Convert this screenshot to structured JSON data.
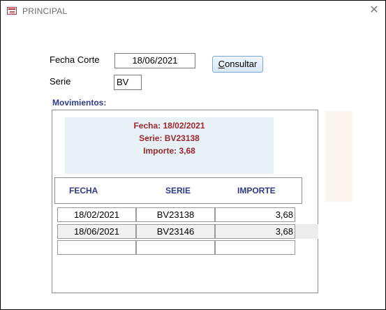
{
  "window": {
    "title": "PRINCIPAL",
    "close_glyph": "✕"
  },
  "form": {
    "fecha_corte_label": "Fecha Corte",
    "fecha_corte_value": "18/06/2021",
    "serie_label": "Serie",
    "serie_value": "BV",
    "consultar_label_first": "C",
    "consultar_label_rest": "onsultar"
  },
  "movimientos": {
    "label": "Movimientos:",
    "summary": {
      "fecha": "Fecha: 18/02/2021",
      "serie": "Serie: BV23138",
      "importe": "Importe: 3,68"
    },
    "columns": [
      "FECHA",
      "SERIE",
      "IMPORTE"
    ],
    "rows": [
      {
        "fecha": "18/02/2021",
        "serie": "BV23138",
        "importe": "3,68"
      },
      {
        "fecha": "18/06/2021",
        "serie": "BV23146",
        "importe": "3,68"
      },
      {
        "fecha": "",
        "serie": "",
        "importe": ""
      }
    ],
    "selected_row": 1
  }
}
